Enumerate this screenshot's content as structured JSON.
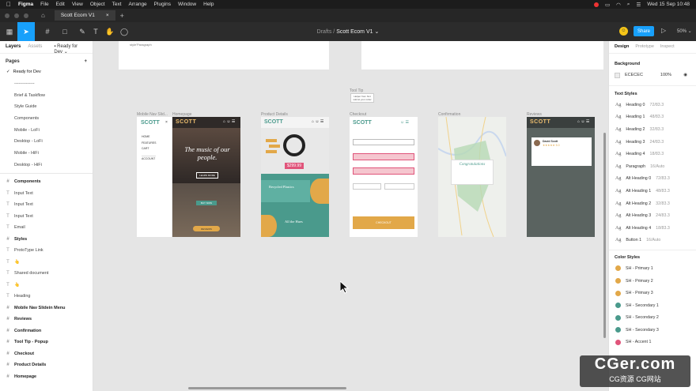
{
  "menubar": {
    "app": "Figma",
    "items": [
      "File",
      "Edit",
      "View",
      "Object",
      "Text",
      "Arrange",
      "Plugins",
      "Window",
      "Help"
    ],
    "clock": "Wed 15 Sep 10:48"
  },
  "tab": {
    "title": "Scott Ecom V1"
  },
  "toolbar": {
    "path_prefix": "Drafts",
    "sep": "/",
    "file": "Scott Ecom V1 ⌄",
    "share": "Share",
    "zoom": "50% ⌄"
  },
  "left_panel": {
    "tabs": [
      "Layers",
      "Assets",
      "Ready for Dev"
    ],
    "pages_title": "Pages",
    "current_page": "Ready for Dev",
    "pages": [
      "--------------",
      "Brief & Taskflow",
      "Style Guide",
      "Components",
      "Mobile - LoFi",
      "Desktop - LoFi",
      "Mobile - HiFi",
      "Desktop - HiFi"
    ],
    "layers": [
      {
        "label": "Components",
        "bold": true,
        "icon": "#"
      },
      {
        "label": "Input Text",
        "bold": false,
        "icon": "T"
      },
      {
        "label": "Input Text",
        "bold": false,
        "icon": "T"
      },
      {
        "label": "Input Text",
        "bold": false,
        "icon": "T"
      },
      {
        "label": "Email",
        "bold": false,
        "icon": "T"
      },
      {
        "label": "Styles",
        "bold": true,
        "icon": "#"
      },
      {
        "label": "ProtoType Link",
        "bold": false,
        "icon": "T"
      },
      {
        "label": "👆",
        "bold": false,
        "icon": "T"
      },
      {
        "label": "Shared document",
        "bold": false,
        "icon": "T"
      },
      {
        "label": "👆",
        "bold": false,
        "icon": "T"
      },
      {
        "label": "Heading",
        "bold": false,
        "icon": "T"
      },
      {
        "label": "Mobile Nav Slidein Menu",
        "bold": true,
        "icon": "#"
      },
      {
        "label": "Reviews",
        "bold": true,
        "icon": "#"
      },
      {
        "label": "Confirmation",
        "bold": true,
        "icon": "#"
      },
      {
        "label": "Tool Tip - Popup",
        "bold": true,
        "icon": "#"
      },
      {
        "label": "Checkout",
        "bold": true,
        "icon": "#"
      },
      {
        "label": "Product Details",
        "bold": true,
        "icon": "#"
      },
      {
        "label": "Homepage",
        "bold": true,
        "icon": "#"
      }
    ]
  },
  "right_panel": {
    "tabs": [
      "Design",
      "Prototype",
      "Inspect"
    ],
    "background_title": "Background",
    "bg_hex": "ECECEC",
    "bg_opacity": "100%",
    "text_styles_title": "Text Styles",
    "text_styles": [
      {
        "name": "Heading 0",
        "size": "72/83.3"
      },
      {
        "name": "Heading 1",
        "size": "48/83.3"
      },
      {
        "name": "Heading 2",
        "size": "32/83.3"
      },
      {
        "name": "Heading 3",
        "size": "24/83.3"
      },
      {
        "name": "Heading 4",
        "size": "18/83.3"
      },
      {
        "name": "Paragraph",
        "size": "16/Auto"
      },
      {
        "name": "Alt Heading 0",
        "size": "72/83.3"
      },
      {
        "name": "Alt Heading 1",
        "size": "48/83.3"
      },
      {
        "name": "Alt Heading 2",
        "size": "32/83.3"
      },
      {
        "name": "Alt Heading 3",
        "size": "24/83.3"
      },
      {
        "name": "Alt Heading 4",
        "size": "18/83.3"
      },
      {
        "name": "Button 1",
        "size": "16/Auto"
      }
    ],
    "color_styles_title": "Color Styles",
    "color_styles": [
      {
        "name": "SH - Primary 1",
        "color": "#e2a849"
      },
      {
        "name": "SH - Primary 2",
        "color": "#e2a849"
      },
      {
        "name": "SH - Primary 3",
        "color": "#e2a849"
      },
      {
        "name": "SH - Secondary 1",
        "color": "#4a9a8c"
      },
      {
        "name": "SH - Secondary 2",
        "color": "#4a9a8c"
      },
      {
        "name": "SH - Secondary 3",
        "color": "#4a9a8c"
      },
      {
        "name": "SH - Accent 1",
        "color": "#e0547a"
      }
    ]
  },
  "canvas": {
    "frames": [
      "Mobile Nav Slid...",
      "Homepage",
      "Product Details",
      "Checkout",
      "Confirmation",
      "Reviews"
    ],
    "tooltip_label": "Tool Tip",
    "tooltip_text": "Helper from hint sold at your order",
    "top_note": "style'Paragraph",
    "nav_items": [
      "HOME",
      "FEATURES",
      "CART",
      "ACCOUNT"
    ],
    "logo": "SCOTT",
    "home_headline": "The music of our people.",
    "home_cta": "LEARN MORE",
    "home_cta2": "BUY NOW",
    "home_cta3": "REVIEWS",
    "price": "$299.99",
    "product_banner": "Recycled Plastics",
    "product_banner2": "All the Hues",
    "checkout_btn": "CHECKOUT",
    "confirm_title": "Congratulations",
    "review_name": "David Scott",
    "review_stars": "★★★★★ 5.0"
  },
  "watermark": {
    "big": "CGer.com",
    "small": "CG资源 CG网站"
  }
}
